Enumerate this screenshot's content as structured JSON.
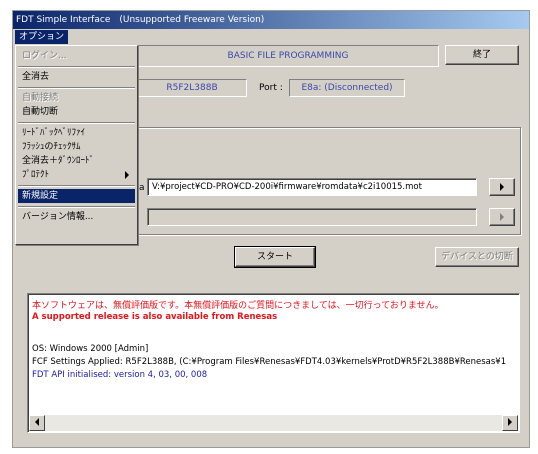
{
  "window": {
    "title": "FDT Simple Interface　(Unsupported Freeware Version)"
  },
  "menubar": {
    "options": "オプション"
  },
  "menu": {
    "items": [
      {
        "label": "ログイン...",
        "state": "disabled"
      },
      {
        "label": "全消去",
        "state": "normal"
      },
      {
        "label": "自動接続",
        "state": "disabled"
      },
      {
        "label": "自動切断",
        "state": "normal"
      },
      {
        "label": "ﾘｰﾄﾞﾊﾞｯｸﾍﾞﾘﾌｧｲ",
        "state": "normal"
      },
      {
        "label": "ﾌﾗｯｼｭのﾁｪｯｸｻﾑ",
        "state": "normal"
      },
      {
        "label": "全消去＋ﾀﾞｳﾝﾛｰﾄﾞ",
        "state": "normal"
      },
      {
        "label": "ﾌﾟﾛﾃｸﾄ",
        "state": "normal",
        "submenu": true
      },
      {
        "label": "新規設定",
        "state": "highlighted"
      },
      {
        "label": "バージョン情報...",
        "state": "normal"
      }
    ]
  },
  "header": {
    "mode_label": "BASIC FILE PROGRAMMING",
    "exit_button": "終了"
  },
  "device": {
    "device_value": "R5F2L388B",
    "port_label": "Port :",
    "port_value": "E8a: (Disconnected)"
  },
  "file": {
    "label_fragment": "a",
    "path": "V:¥project¥CD-PRO¥CD-200i¥firmware¥romdata¥c2i10015.mot",
    "browse_icon": "arrow-right-icon"
  },
  "actions": {
    "start_button": "スタート",
    "disconnect_button": "デバイスとの切断"
  },
  "log": {
    "warning_jp": "本ソフトウェアは、無償評価版です。本無償評価版のご質問につきましては、一切行っておりません。",
    "warning_en": "A supported release is also available from Renesas",
    "os_line": "OS: Windows 2000 [Admin]",
    "fcf_line": "FCF Settings Applied: R5F2L388B, (C:¥Program Files¥Renesas¥FDT4.03¥kernels¥ProtD¥R5F2L388B¥Renesas¥1",
    "api_line": "FDT API initialised: version 4, 03, 00, 008"
  },
  "colors": {
    "title_gradient_start": "#0a246a",
    "title_gradient_end": "#a6caf0",
    "face": "#d4d0c8",
    "warning_red": "#e8141c",
    "api_blue": "#1a1aa8",
    "label_blue": "#3a49a8"
  }
}
